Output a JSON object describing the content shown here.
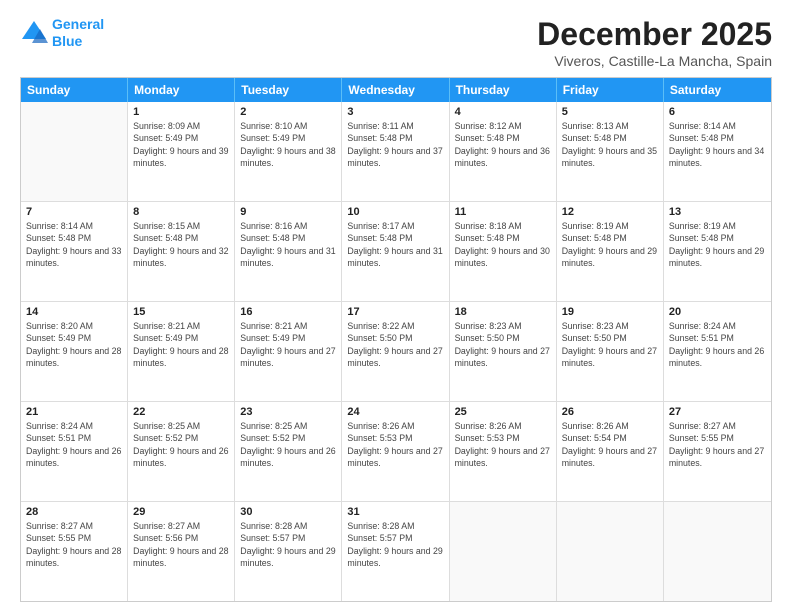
{
  "logo": {
    "line1": "General",
    "line2": "Blue"
  },
  "title": "December 2025",
  "location": "Viveros, Castille-La Mancha, Spain",
  "days_of_week": [
    "Sunday",
    "Monday",
    "Tuesday",
    "Wednesday",
    "Thursday",
    "Friday",
    "Saturday"
  ],
  "weeks": [
    [
      {
        "day": "",
        "sunrise": "",
        "sunset": "",
        "daylight": ""
      },
      {
        "day": "1",
        "sunrise": "8:09 AM",
        "sunset": "5:49 PM",
        "daylight": "9 hours and 39 minutes."
      },
      {
        "day": "2",
        "sunrise": "8:10 AM",
        "sunset": "5:49 PM",
        "daylight": "9 hours and 38 minutes."
      },
      {
        "day": "3",
        "sunrise": "8:11 AM",
        "sunset": "5:48 PM",
        "daylight": "9 hours and 37 minutes."
      },
      {
        "day": "4",
        "sunrise": "8:12 AM",
        "sunset": "5:48 PM",
        "daylight": "9 hours and 36 minutes."
      },
      {
        "day": "5",
        "sunrise": "8:13 AM",
        "sunset": "5:48 PM",
        "daylight": "9 hours and 35 minutes."
      },
      {
        "day": "6",
        "sunrise": "8:14 AM",
        "sunset": "5:48 PM",
        "daylight": "9 hours and 34 minutes."
      }
    ],
    [
      {
        "day": "7",
        "sunrise": "8:14 AM",
        "sunset": "5:48 PM",
        "daylight": "9 hours and 33 minutes."
      },
      {
        "day": "8",
        "sunrise": "8:15 AM",
        "sunset": "5:48 PM",
        "daylight": "9 hours and 32 minutes."
      },
      {
        "day": "9",
        "sunrise": "8:16 AM",
        "sunset": "5:48 PM",
        "daylight": "9 hours and 31 minutes."
      },
      {
        "day": "10",
        "sunrise": "8:17 AM",
        "sunset": "5:48 PM",
        "daylight": "9 hours and 31 minutes."
      },
      {
        "day": "11",
        "sunrise": "8:18 AM",
        "sunset": "5:48 PM",
        "daylight": "9 hours and 30 minutes."
      },
      {
        "day": "12",
        "sunrise": "8:19 AM",
        "sunset": "5:48 PM",
        "daylight": "9 hours and 29 minutes."
      },
      {
        "day": "13",
        "sunrise": "8:19 AM",
        "sunset": "5:48 PM",
        "daylight": "9 hours and 29 minutes."
      }
    ],
    [
      {
        "day": "14",
        "sunrise": "8:20 AM",
        "sunset": "5:49 PM",
        "daylight": "9 hours and 28 minutes."
      },
      {
        "day": "15",
        "sunrise": "8:21 AM",
        "sunset": "5:49 PM",
        "daylight": "9 hours and 28 minutes."
      },
      {
        "day": "16",
        "sunrise": "8:21 AM",
        "sunset": "5:49 PM",
        "daylight": "9 hours and 27 minutes."
      },
      {
        "day": "17",
        "sunrise": "8:22 AM",
        "sunset": "5:50 PM",
        "daylight": "9 hours and 27 minutes."
      },
      {
        "day": "18",
        "sunrise": "8:23 AM",
        "sunset": "5:50 PM",
        "daylight": "9 hours and 27 minutes."
      },
      {
        "day": "19",
        "sunrise": "8:23 AM",
        "sunset": "5:50 PM",
        "daylight": "9 hours and 27 minutes."
      },
      {
        "day": "20",
        "sunrise": "8:24 AM",
        "sunset": "5:51 PM",
        "daylight": "9 hours and 26 minutes."
      }
    ],
    [
      {
        "day": "21",
        "sunrise": "8:24 AM",
        "sunset": "5:51 PM",
        "daylight": "9 hours and 26 minutes."
      },
      {
        "day": "22",
        "sunrise": "8:25 AM",
        "sunset": "5:52 PM",
        "daylight": "9 hours and 26 minutes."
      },
      {
        "day": "23",
        "sunrise": "8:25 AM",
        "sunset": "5:52 PM",
        "daylight": "9 hours and 26 minutes."
      },
      {
        "day": "24",
        "sunrise": "8:26 AM",
        "sunset": "5:53 PM",
        "daylight": "9 hours and 27 minutes."
      },
      {
        "day": "25",
        "sunrise": "8:26 AM",
        "sunset": "5:53 PM",
        "daylight": "9 hours and 27 minutes."
      },
      {
        "day": "26",
        "sunrise": "8:26 AM",
        "sunset": "5:54 PM",
        "daylight": "9 hours and 27 minutes."
      },
      {
        "day": "27",
        "sunrise": "8:27 AM",
        "sunset": "5:55 PM",
        "daylight": "9 hours and 27 minutes."
      }
    ],
    [
      {
        "day": "28",
        "sunrise": "8:27 AM",
        "sunset": "5:55 PM",
        "daylight": "9 hours and 28 minutes."
      },
      {
        "day": "29",
        "sunrise": "8:27 AM",
        "sunset": "5:56 PM",
        "daylight": "9 hours and 28 minutes."
      },
      {
        "day": "30",
        "sunrise": "8:28 AM",
        "sunset": "5:57 PM",
        "daylight": "9 hours and 29 minutes."
      },
      {
        "day": "31",
        "sunrise": "8:28 AM",
        "sunset": "5:57 PM",
        "daylight": "9 hours and 29 minutes."
      },
      {
        "day": "",
        "sunrise": "",
        "sunset": "",
        "daylight": ""
      },
      {
        "day": "",
        "sunrise": "",
        "sunset": "",
        "daylight": ""
      },
      {
        "day": "",
        "sunrise": "",
        "sunset": "",
        "daylight": ""
      }
    ]
  ]
}
